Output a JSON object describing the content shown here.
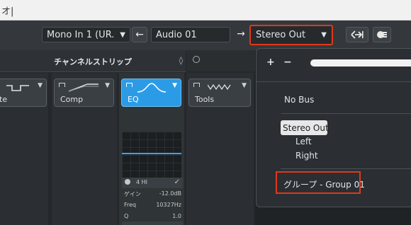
{
  "window": {
    "title_fragment": "オ|"
  },
  "toolbar": {
    "input_routing": "Mono In 1 (UR.",
    "channel_name": "Audio 01",
    "output_routing": "Stereo Out",
    "dropdown_caret": "▼",
    "back_arrow": "←",
    "forward_arrow": "→"
  },
  "channel_strip": {
    "title": "チャンネルストリップ",
    "modules": [
      {
        "label": "te"
      },
      {
        "label": "Comp"
      },
      {
        "label": "EQ"
      },
      {
        "label": "Tools"
      }
    ],
    "eq": {
      "band": "4 HI",
      "params": [
        {
          "key": "ゲイン",
          "value": "-12.0dB"
        },
        {
          "key": "Freq",
          "value": "10327Hz"
        },
        {
          "key": "Q",
          "value": "1.0"
        }
      ]
    }
  },
  "bus_menu": {
    "add": "+",
    "remove": "−",
    "items": {
      "no_bus": "No Bus",
      "stereo_out": "Stereo Out",
      "left": "Left",
      "right": "Right",
      "group": "グループ - Group 01"
    }
  },
  "colors": {
    "accent": "#2c9be6",
    "highlight_box": "#e0381a"
  }
}
